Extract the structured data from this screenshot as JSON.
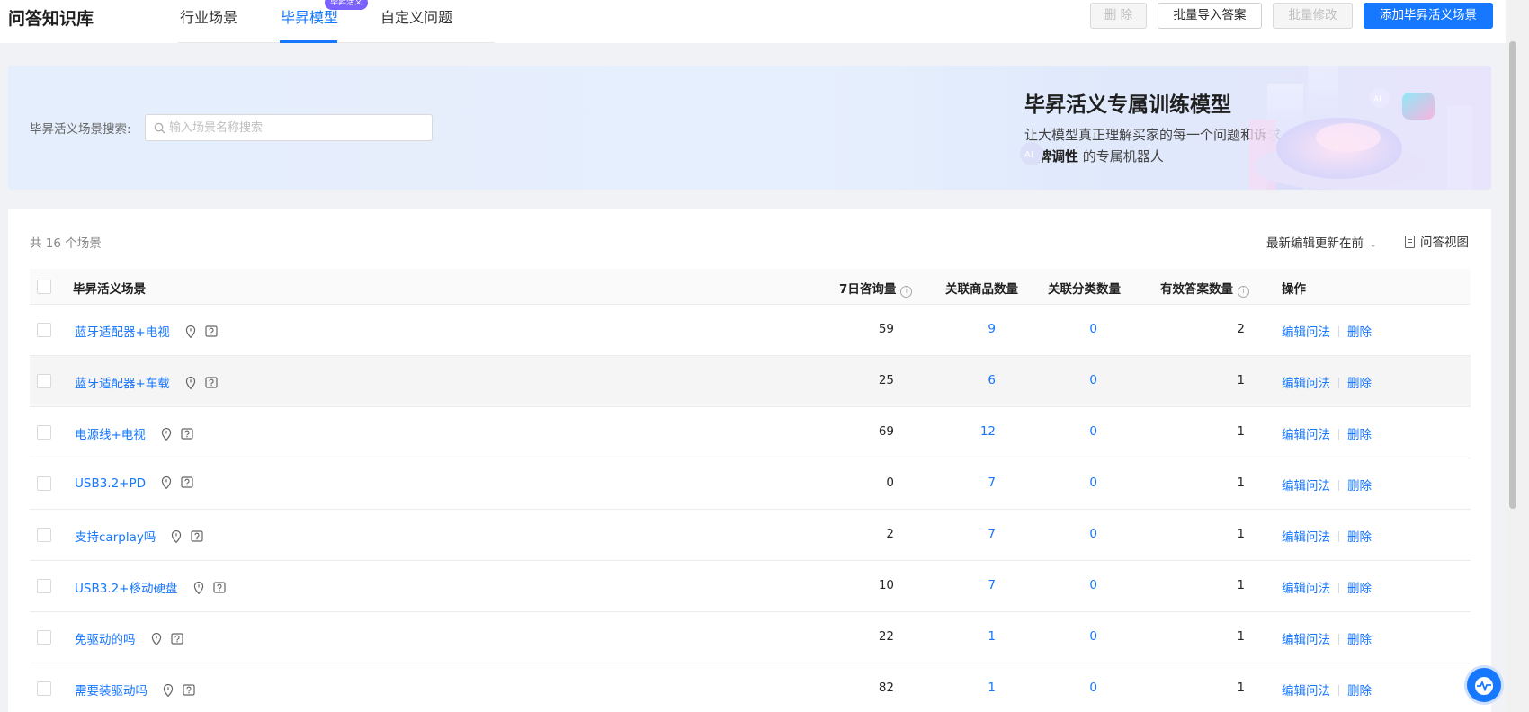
{
  "header": {
    "title": "问答知识库",
    "tabs": [
      {
        "label": "行业场景",
        "active": false
      },
      {
        "label": "毕昇模型",
        "active": true,
        "badge": "毕昇活义"
      },
      {
        "label": "自定义问题",
        "active": false
      }
    ],
    "buttons": {
      "delete": "删 除",
      "bulk_import": "批量导入答案",
      "bulk_edit": "批量修改",
      "add_scene": "添加毕昇活义场景"
    }
  },
  "banner": {
    "search_label": "毕昇活义场景搜索:",
    "search_placeholder": "输入场景名称搜索",
    "title": "毕昇活义专属训练模型",
    "desc_line1": "让大模型真正理解买家的每一个问题和诉求，打造拥有",
    "desc_bold": "品牌调性",
    "desc_rest": " 的专属机器人"
  },
  "list": {
    "count_text": "共 16 个场景",
    "sort_label": "最新编辑更新在前",
    "view_label": "问答视图",
    "columns": {
      "scene": "毕昇活义场景",
      "consult": "7日咨询量",
      "products": "关联商品数量",
      "categories": "关联分类数量",
      "answers": "有效答案数量",
      "actions": "操作"
    },
    "action_edit": "编辑问法",
    "action_delete": "删除",
    "rows": [
      {
        "name": "蓝牙适配器+电视",
        "consult": "59",
        "products": "9",
        "categories": "0",
        "answers": "2"
      },
      {
        "name": "蓝牙适配器+车载",
        "consult": "25",
        "products": "6",
        "categories": "0",
        "answers": "1"
      },
      {
        "name": "电源线+电视",
        "consult": "69",
        "products": "12",
        "categories": "0",
        "answers": "1"
      },
      {
        "name": "USB3.2+PD",
        "consult": "0",
        "products": "7",
        "categories": "0",
        "answers": "1"
      },
      {
        "name": "支持carplay吗",
        "consult": "2",
        "products": "7",
        "categories": "0",
        "answers": "1"
      },
      {
        "name": "USB3.2+移动硬盘",
        "consult": "10",
        "products": "7",
        "categories": "0",
        "answers": "1"
      },
      {
        "name": "免驱动的吗",
        "consult": "22",
        "products": "1",
        "categories": "0",
        "answers": "1"
      },
      {
        "name": "需要装驱动吗",
        "consult": "82",
        "products": "1",
        "categories": "0",
        "answers": "1"
      }
    ]
  },
  "colors": {
    "primary": "#1677ff",
    "badge": "#7b61ff"
  }
}
